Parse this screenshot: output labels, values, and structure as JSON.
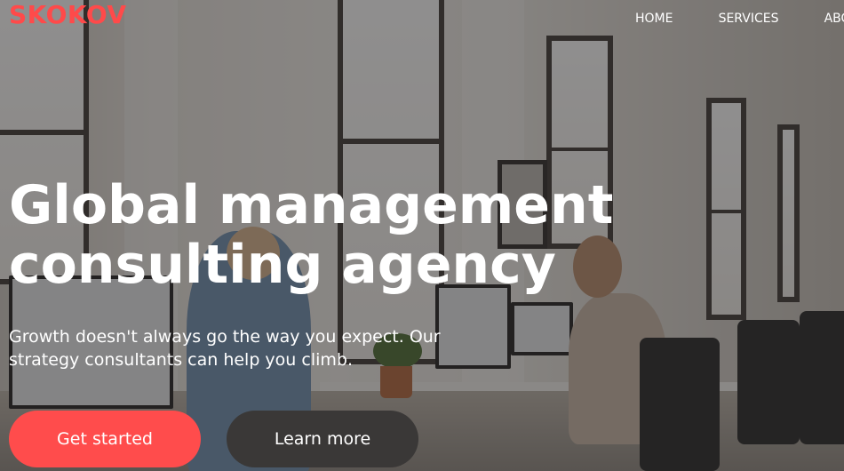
{
  "brand": {
    "logo_text": "SKOKOV",
    "accent_color": "#ff4c4c"
  },
  "nav": {
    "items": [
      {
        "label": "HOME"
      },
      {
        "label": "SERVICES"
      },
      {
        "label": "ABOUT"
      }
    ]
  },
  "hero": {
    "title_line1": "Global management",
    "title_line2": "consulting agency",
    "subtitle": "Growth doesn't always go the way you expect. Our strategy consultants can help you climb.",
    "primary_button": "Get started",
    "secondary_button": "Learn more"
  }
}
